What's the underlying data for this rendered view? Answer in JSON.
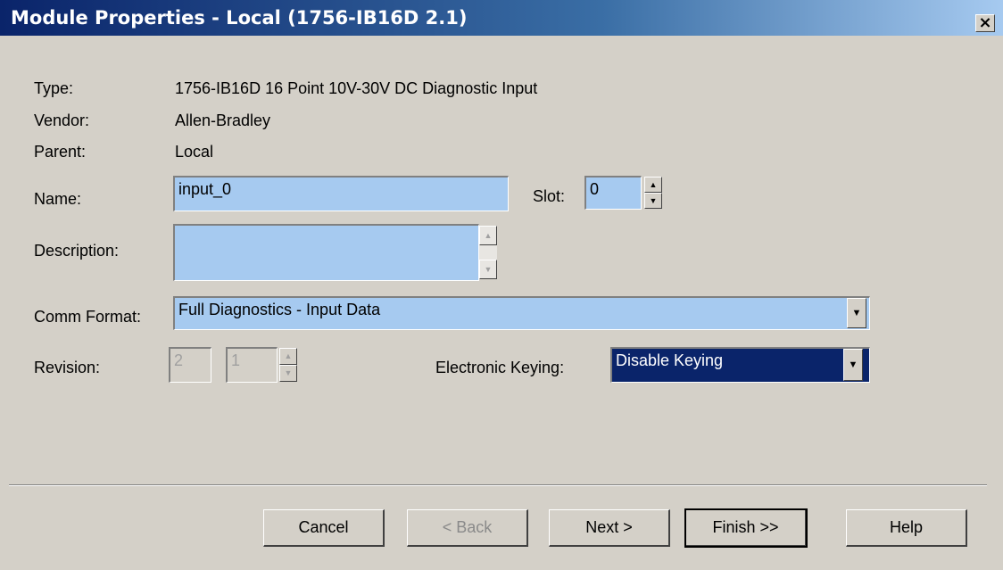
{
  "window": {
    "title": "Module Properties - Local (1756-IB16D 2.1)",
    "close_symbol": "×"
  },
  "info": {
    "type_label": "Type:",
    "type_value": "1756-IB16D 16 Point 10V-30V DC Diagnostic Input",
    "vendor_label": "Vendor:",
    "vendor_value": "Allen-Bradley",
    "parent_label": "Parent:",
    "parent_value": "Local"
  },
  "name": {
    "label": "Name:",
    "value": "input_0"
  },
  "slot": {
    "label": "Slot:",
    "value": "0"
  },
  "description": {
    "label": "Description:",
    "value": ""
  },
  "comm_format": {
    "label": "Comm Format:",
    "value": "Full Diagnostics - Input Data"
  },
  "revision": {
    "label": "Revision:",
    "major": "2",
    "minor": "1"
  },
  "electronic_keying": {
    "label": "Electronic Keying:",
    "value": "Disable Keying"
  },
  "buttons": {
    "cancel": "Cancel",
    "back": "< Back",
    "next": "Next >",
    "finish": "Finish >>",
    "help": "Help"
  },
  "icons": {
    "arrow_up": "▲",
    "arrow_down": "▼"
  }
}
